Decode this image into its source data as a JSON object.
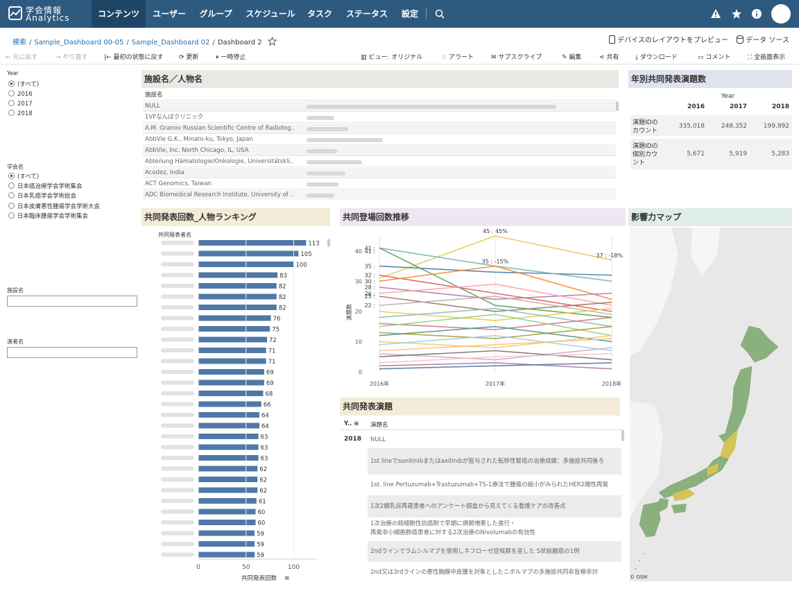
{
  "app": {
    "logo_line1": "学会情報",
    "logo_line2": "Analytics"
  },
  "nav": {
    "items": [
      "コンテンツ",
      "ユーザー",
      "グループ",
      "スケジュール",
      "タスク",
      "ステータス",
      "設定"
    ],
    "active": "コンテンツ"
  },
  "breadcrumb": {
    "items": [
      "検索",
      "Sample_Dashboard 00-05",
      "Sample_Dashboard 02",
      "Dashboard 2"
    ]
  },
  "header_links": {
    "device_preview": "デバイスのレイアウトをプレビュー",
    "data_source": "データ ソース"
  },
  "toolbar": {
    "undo": "元に戻す",
    "redo": "やり直す",
    "revert": "最初の状態に戻す",
    "refresh": "更新",
    "pause": "一時停止",
    "view": "ビュー: オリジナル",
    "alert": "アラート",
    "subscribe": "サブスクライブ",
    "edit": "編集",
    "share": "共有",
    "download": "ダウンロード",
    "comment": "コメント",
    "fullscreen": "全画面表示"
  },
  "filters": {
    "year": {
      "label": "Year",
      "options": [
        "(すべて)",
        "2016",
        "2017",
        "2018"
      ],
      "selected": "(すべて)"
    },
    "society": {
      "label": "学会名",
      "options": [
        "(すべて)",
        "日本癌治療学会学術集会",
        "日本乳癌学会学術総会",
        "日本皮膚悪性腫瘍学会学術大会",
        "日本臨床腫瘍学会学術集会"
      ],
      "selected": "(すべて)"
    },
    "facility": {
      "label": "施設名",
      "value": ""
    },
    "presenter": {
      "label": "演者名",
      "value": ""
    }
  },
  "facility_panel": {
    "title": "施設名／人物名",
    "column": "施設名",
    "rows": [
      "NULL",
      "1VFなんばクリニック",
      "A.M. Granov Russian Scientific Centre of Radiolog..",
      "AbbVie G.K., Minato-ku, Tokyo, Japan",
      "AbbVie, Inc. North Chicago, IL, USA",
      "Abteilung Hämatologie/Onkologie, Universitätskli..",
      "Acodez, India",
      "ACT Genomics, Taiwan",
      "ADC Biomedical Research Institute, University of .."
    ]
  },
  "yearly_panel": {
    "title": "年別共同発表演題数",
    "header": "Year",
    "years": [
      "2016",
      "2017",
      "2018"
    ],
    "rows": [
      {
        "label": [
          "演題IDの",
          "カウント"
        ],
        "values": [
          "335,018",
          "248,352",
          "199,992"
        ]
      },
      {
        "label": [
          "演題IDの",
          "個別カウ",
          "ント"
        ],
        "values": [
          "5,671",
          "5,919",
          "5,283"
        ]
      }
    ]
  },
  "ranking_panel": {
    "title": "共同発表回数_人物ランキング",
    "row_header": "共同発表者名",
    "x_title": "共同発表回数",
    "x_ticks": [
      "0",
      "50",
      "100"
    ]
  },
  "trend_panel": {
    "title": "共同登場回数推移",
    "y_title": "演題数"
  },
  "map_panel": {
    "title": "影響力マップ",
    "credit": "© OSM"
  },
  "presentations_panel": {
    "title": "共同発表演題",
    "col_year": "Y..",
    "col_title": "演題名",
    "year": "2018",
    "rows": [
      [
        "NULL"
      ],
      [
        "1st lineでsunitinibまたはaxitinibが投与された転移性腎癌の治療成績：多施設共同後ろ"
      ],
      [
        "1st. line Pertuzumab+Trastuzumab+TS-1療法で腫瘍の縮小がみられたHER2陽性再発"
      ],
      [
        "1次2期乳房再建患者へのアンケート調査から見えてくる看護ケアの改善点"
      ],
      [
        "1次治療の殺細胞性抗癌剤で早期に病勢増悪した進行・",
        "再発非小細胞肺癌患者に対する2次治療のNivolumabの有効性"
      ],
      [
        "2ndラインでラムシルマブを使用しネフローゼ症候群を呈した S状結腸癌の1例"
      ],
      [
        "2nd又は3rdラインの悪性胸膜中皮腫を対象としたニボルマブの多施設共同非盲検非対"
      ]
    ]
  },
  "colors": {
    "nav_bg": "#2f5a80",
    "bar": "#4e79a7",
    "map_fill": "#8ab17d",
    "map_highlight": "#d4c35a"
  },
  "chart_data": [
    {
      "type": "bar",
      "title": "共同発表回数_人物ランキング",
      "xlabel": "共同発表回数",
      "ylabel": "共同発表者名",
      "xlim": [
        0,
        120
      ],
      "values": [
        113,
        105,
        100,
        83,
        82,
        82,
        82,
        76,
        75,
        72,
        71,
        71,
        69,
        69,
        68,
        66,
        64,
        64,
        63,
        63,
        63,
        62,
        62,
        62,
        61,
        60,
        60,
        59,
        59,
        59
      ]
    },
    {
      "type": "line",
      "title": "共同登場回数推移",
      "ylabel": "演題数",
      "x": [
        "2016年",
        "2017年",
        "2018年"
      ],
      "ylim": [
        0,
        45
      ],
      "y_ticks": [
        0,
        10,
        20,
        30,
        40
      ],
      "value_labels": [
        {
          "text": "41",
          "x": "2016年",
          "y": 41
        },
        {
          "text": "41",
          "x": "2016年",
          "y": 40
        },
        {
          "text": "35",
          "x": "2016年",
          "y": 35
        },
        {
          "text": "32",
          "x": "2016年",
          "y": 32
        },
        {
          "text": "30",
          "x": "2016年",
          "y": 30
        },
        {
          "text": "28",
          "x": "2016年",
          "y": 28
        },
        {
          "text": "26",
          "x": "2016年",
          "y": 26
        },
        {
          "text": "25",
          "x": "2016年",
          "y": 25
        },
        {
          "text": "22",
          "x": "2016年",
          "y": 22
        }
      ],
      "annotations": [
        {
          "text": "45 : 45%",
          "x": "2017年",
          "y": 45
        },
        {
          "text": "35 : -15%",
          "x": "2017年",
          "y": 35
        },
        {
          "text": "37 : -18%",
          "x": "2018年",
          "y": 37
        }
      ],
      "series": [
        {
          "values": [
            31,
            45,
            37
          ],
          "color": "#e8c75a"
        },
        {
          "values": [
            35,
            33,
            32
          ],
          "color": "#4e79a7"
        },
        {
          "values": [
            41,
            35,
            30
          ],
          "color": "#76b7b2"
        },
        {
          "values": [
            41,
            22,
            18
          ],
          "color": "#59a14f"
        },
        {
          "values": [
            32,
            26,
            20
          ],
          "color": "#e15759"
        },
        {
          "values": [
            30,
            35,
            24
          ],
          "color": "#f28e2b"
        },
        {
          "values": [
            28,
            24,
            26
          ],
          "color": "#af7aa1"
        },
        {
          "values": [
            26,
            29,
            22
          ],
          "color": "#ff9da7"
        },
        {
          "values": [
            25,
            20,
            23
          ],
          "color": "#9c755f"
        },
        {
          "values": [
            22,
            25,
            19
          ],
          "color": "#bab0ac"
        },
        {
          "values": [
            20,
            17,
            21
          ],
          "color": "#edc948"
        },
        {
          "values": [
            18,
            21,
            15
          ],
          "color": "#86bcb6"
        },
        {
          "values": [
            16,
            14,
            18
          ],
          "color": "#d37295"
        },
        {
          "values": [
            15,
            19,
            12
          ],
          "color": "#8cd17d"
        },
        {
          "values": [
            13,
            11,
            15
          ],
          "color": "#b6992d"
        },
        {
          "values": [
            12,
            15,
            10
          ],
          "color": "#499894"
        },
        {
          "values": [
            10,
            8,
            12
          ],
          "color": "#f1ce63"
        },
        {
          "values": [
            9,
            12,
            7
          ],
          "color": "#a0cbe8"
        },
        {
          "values": [
            7,
            9,
            11
          ],
          "color": "#ffbe7d"
        },
        {
          "values": [
            6,
            4,
            8
          ],
          "color": "#d4a6c8"
        },
        {
          "values": [
            5,
            7,
            4
          ],
          "color": "#79706e"
        },
        {
          "values": [
            3,
            5,
            6
          ],
          "color": "#fabfd2"
        },
        {
          "values": [
            2,
            3,
            1
          ],
          "color": "#b07aa1"
        },
        {
          "values": [
            1,
            2,
            3
          ],
          "color": "#4e79a7"
        }
      ]
    }
  ]
}
